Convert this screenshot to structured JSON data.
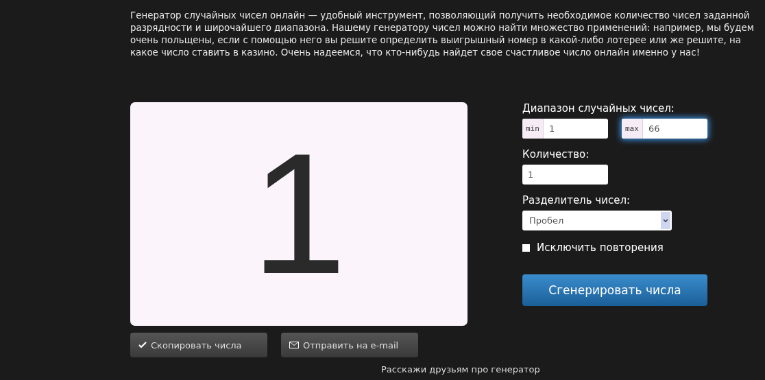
{
  "intro": "Генератор случайных чисел онлайн — удобный инструмент, позволяющий получить необходимое количество чисел заданной разрядности и широчайшего диапазона. Нашему генератору чисел можно найти множество применений: например, мы будем очень польщены, если с помощью него вы решите определить выигрышный номер в какой-либо лотерее или же решите, на какое число ставить в казино. Очень надеемся, что кто-нибудь найдет свое счастливое число онлайн именно у нас!",
  "display": {
    "value": "1"
  },
  "form": {
    "range_label": "Диапазон случайных чисел:",
    "range": [
      {
        "prefix": "min",
        "value": "1",
        "focused": false
      },
      {
        "prefix": "max",
        "value": "66",
        "focused": true
      }
    ],
    "count_label": "Количество:",
    "count": "1",
    "separator_label": "Разделитель чисел:",
    "separator": "Пробел",
    "exclude": {
      "label": "Исключить повторения",
      "checked": false
    },
    "generate": "Сгенерировать числа"
  },
  "actions": [
    {
      "kind": "copy",
      "label": "Скопировать числа"
    },
    {
      "kind": "email",
      "label": "Отправить на e-mail"
    }
  ],
  "share": "Расскажи друзьям про генератор"
}
